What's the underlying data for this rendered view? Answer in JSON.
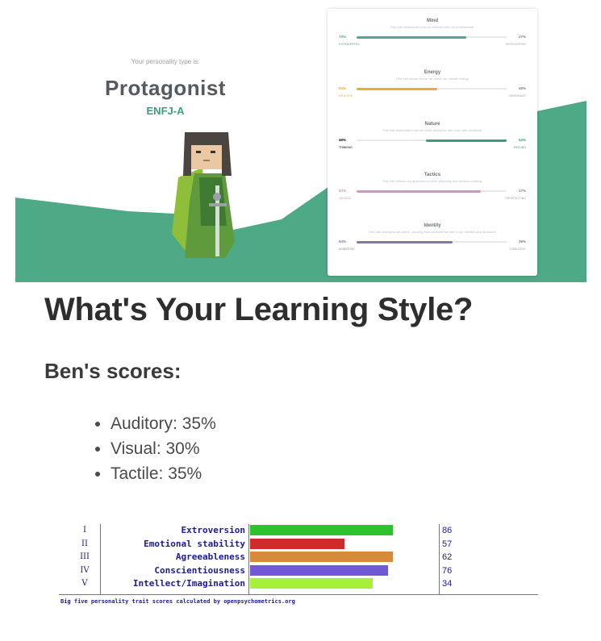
{
  "personality": {
    "intro": "Your personality type is:",
    "type_name": "Protagonist",
    "type_code": "ENFJ-A",
    "traits": [
      {
        "name": "Mind",
        "description": "This trait determines how we interact with our environment.",
        "left_pct": "73%",
        "right_pct": "27%",
        "left_label": "EXTRAVERTED",
        "right_label": "INTROVERTED",
        "fill_from": "left",
        "fill_fraction": 0.73,
        "color": "#4da89a"
      },
      {
        "name": "Energy",
        "description": "This trait shows where we direct our mental energy.",
        "left_pct": "54%",
        "right_pct": "46%",
        "left_label": "INTUITIVE",
        "right_label": "OBSERVANT",
        "fill_from": "left",
        "fill_fraction": 0.54,
        "color": "#e4ae3a"
      },
      {
        "name": "Nature",
        "description": "This trait determines how we make decisions and cope with emotions.",
        "left_pct": "46%",
        "right_pct": "54%",
        "left_label": "THINKING",
        "right_label": "FEELING",
        "fill_from": "right",
        "fill_fraction": 0.54,
        "color": "#36a176"
      },
      {
        "name": "Tactics",
        "description": "This trait reflects our approach to work, planning and decision-making.",
        "left_pct": "83%",
        "right_pct": "17%",
        "left_label": "JUDGING",
        "right_label": "PROSPECTING",
        "fill_from": "left",
        "fill_fraction": 0.83,
        "color": "#c99abf"
      },
      {
        "name": "Identity",
        "description": "This trait underpins all others, showing how confident we are in our abilities and decisions.",
        "left_pct": "64%",
        "right_pct": "36%",
        "left_label": "ASSERTIVE",
        "right_label": "TURBULENT",
        "fill_from": "left",
        "fill_fraction": 0.64,
        "color": "#8b76a8"
      }
    ],
    "colors": {
      "terrain": "#4ea987",
      "accent": "#35a37a"
    }
  },
  "learning_style": {
    "title": "What's Your Learning Style?",
    "subtitle": "Ben's scores:",
    "scores": [
      {
        "text": "Auditory: 35%"
      },
      {
        "text": "Visual: 30%"
      },
      {
        "text": "Tactile: 35%"
      }
    ]
  },
  "big_five": {
    "rows": [
      {
        "num": "I",
        "label": "Extroversion",
        "value": "86",
        "bar_fraction": 0.86,
        "color": "#2ec12e"
      },
      {
        "num": "II",
        "label": "Emotional stability",
        "value": "57",
        "bar_fraction": 0.57,
        "color": "#cf2b2b"
      },
      {
        "num": "III",
        "label": "Agreeableness",
        "value": "62",
        "bar_fraction": 0.86,
        "color": "#d68b3c"
      },
      {
        "num": "IV",
        "label": "Conscientiousness",
        "value": "76",
        "bar_fraction": 0.83,
        "color": "#7159d6"
      },
      {
        "num": "V",
        "label": "Intellect/Imagination",
        "value": "34",
        "bar_fraction": 0.74,
        "color": "#a6f03a"
      }
    ],
    "caption": "Big five personality trait scores calculated by openpsychometrics.org"
  }
}
